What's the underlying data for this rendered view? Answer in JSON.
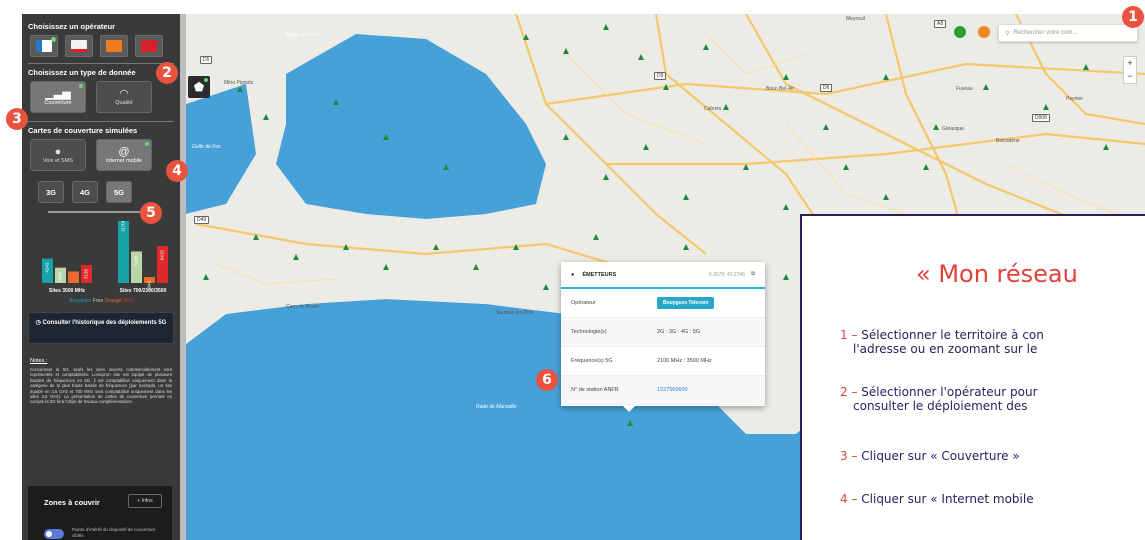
{
  "sidebar": {
    "operator_title": "Choisissez un opérateur",
    "data_type_title": "Choisissez un type de donnée",
    "coverage_label": "Couverture",
    "quality_label": "Qualité",
    "simulated_title": "Cartes de couverture simulées",
    "voice_label": "Voix et SMS",
    "internet_label": "Internet mobile",
    "tech": [
      "3G",
      "4G",
      "5G"
    ],
    "history_button": "Consulter l'historique des déploiements 5G",
    "notes_title": "Notes :",
    "notes_body": "Concernant la 5G, seuls les sites ouverts commercialement sont représentés et comptabilisés. Lorsqu'un site est équipé de plusieurs bandes de fréquences en 5G, il est comptabilisé uniquement dans la catégorie de la plus haute bande de fréquences (par exemple, un site équipé en 3,5 GHz et 700 MHz sera comptabilisé uniquement dans les sites 3,5 GHz). La présentation de cartes de couverture prenant en compte la 5G fera l'objet de travaux complémentaires.",
    "zones_title": "Zones à couvrir",
    "zones_button": "+ Infos",
    "zones_toggle_label": "Points d'intérêt du dispositif de couverture ciblée"
  },
  "chart_data": {
    "type": "bar",
    "categories": [
      "Sites 3500 MHz",
      "Sites 700/2100/3500"
    ],
    "series": [
      {
        "name": "Bouygues",
        "values": [
          4243,
          11708
        ]
      },
      {
        "name": "Free",
        "values": [
          2668,
          5486
        ]
      },
      {
        "name": "Orange",
        "values": [
          2000,
          1044
        ]
      },
      {
        "name": "SFR",
        "values": [
          3136,
          6415
        ]
      }
    ],
    "legend": "Bouygues Free Orange SFR",
    "colors": [
      "#17a2a8",
      "#b9d7a6",
      "#ea6b2e",
      "#e02a2a"
    ],
    "bar_labels": [
      [
        "4243",
        "2668",
        "",
        "3136"
      ],
      [
        "11708",
        "5486",
        "1044",
        "6415"
      ]
    ]
  },
  "map": {
    "search_placeholder": "Rechercher votre com...",
    "labels": [
      "Mitro Pignots",
      "Bouc-Bel-Air",
      "Gréasque",
      "Belcodène",
      "Fuveau",
      "Peynier",
      "Cabriès",
      "Meyreuil",
      "Sausset-les-Pins",
      "Carry-le-Rouet"
    ],
    "roads": [
      "D5",
      "D9",
      "D6",
      "D908",
      "D49",
      "A8"
    ],
    "sea_labels": [
      "Étang de Berre",
      "Golfe de Fos",
      "Rade de Marseille"
    ]
  },
  "popup": {
    "title": "ÉMETTEURS",
    "coords": "5.3079, 43.2746",
    "rows": [
      {
        "key": "Opérateur",
        "value": "Bouygues Telecom"
      },
      {
        "key": "Technologie(s)",
        "value": "2G : 3G : 4G : 5G"
      },
      {
        "key": "Fréquence(s) 5G",
        "value": "2100 MHz : 3500 MHz"
      },
      {
        "key": "N° de station ANFR",
        "value": "1327560600"
      }
    ]
  },
  "steps": [
    "1",
    "2",
    "3",
    "4",
    "5",
    "6"
  ],
  "panel": {
    "title": "« Mon réseau",
    "items": [
      {
        "num": "1 – ",
        "text": "Sélectionner le territoire à con",
        "cont": "l'adresse ou en zoomant sur le"
      },
      {
        "num": "2 – ",
        "text": "Sélectionner l'opérateur pour",
        "cont": "consulter le déploiement des"
      },
      {
        "num": "3 – ",
        "text": "Cliquer sur « Couverture »",
        "cont": ""
      },
      {
        "num": "4 – ",
        "text": "Cliquer sur « Internet mobile",
        "cont": ""
      }
    ]
  }
}
